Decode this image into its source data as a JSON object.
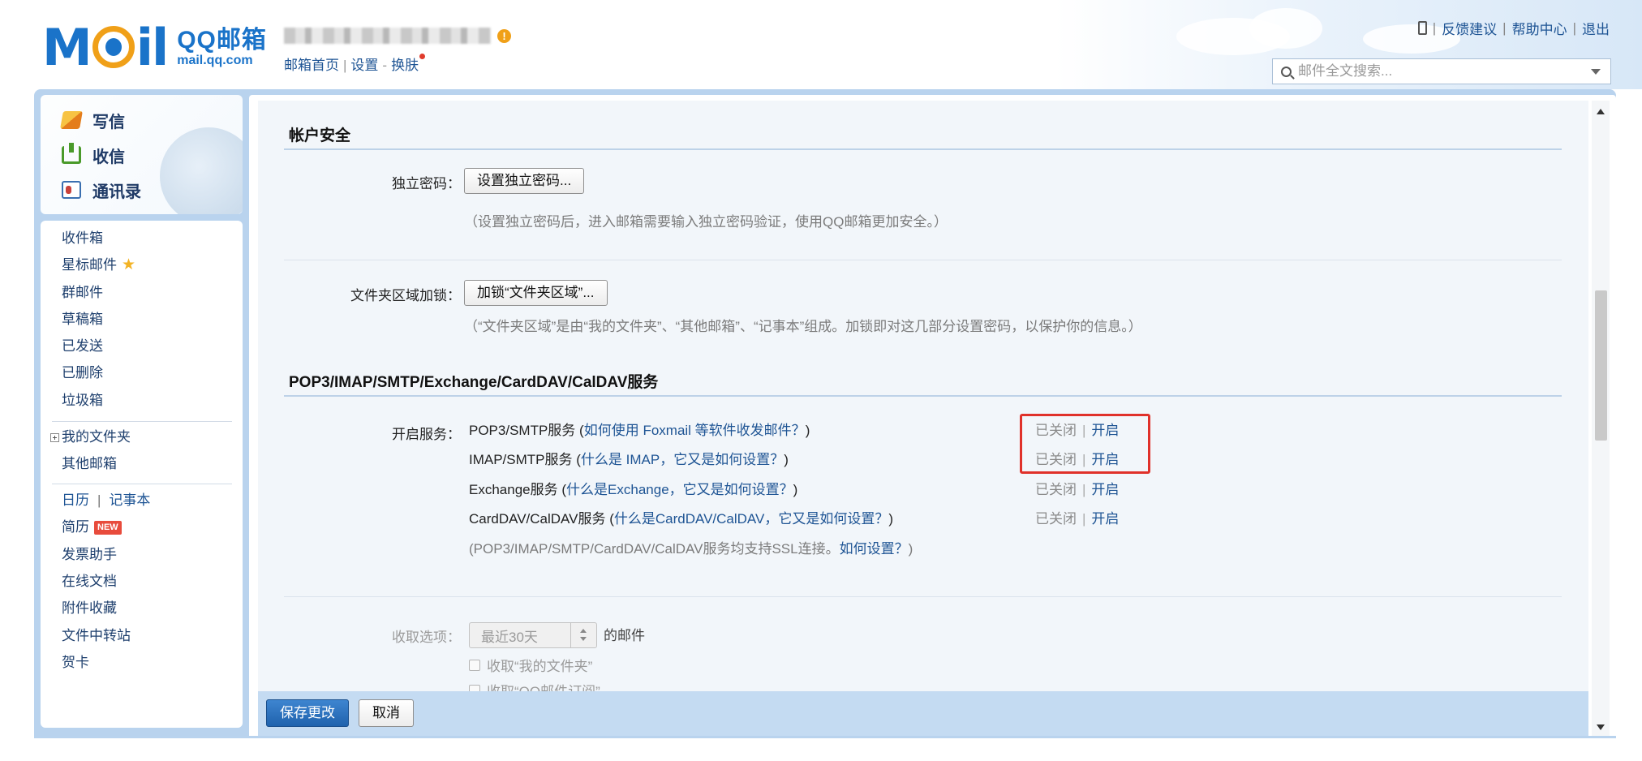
{
  "header": {
    "logo_cn": "QQ邮箱",
    "logo_en": "mail.qq.com",
    "user_links": [
      "邮箱首页",
      "设置",
      "换肤"
    ],
    "top_links": [
      "反馈建议",
      "帮助中心",
      "退出"
    ],
    "search_placeholder": "邮件全文搜索..."
  },
  "sidebar": {
    "actions": [
      "写信",
      "收信",
      "通讯录"
    ],
    "folders": [
      "收件箱",
      "星标邮件",
      "群邮件",
      "草稿箱",
      "已发送",
      "已删除",
      "垃圾箱"
    ],
    "my_folders": "我的文件夹",
    "other_mailbox": "其他邮箱",
    "calendar": "日历",
    "notes": "记事本",
    "resume": "简历",
    "new_badge": "NEW",
    "tools": [
      "发票助手",
      "在线文档",
      "附件收藏",
      "文件中转站",
      "贺卡"
    ]
  },
  "account_security": {
    "title": "帐户安全",
    "independent_password_label": "独立密码：",
    "independent_password_button": "设置独立密码...",
    "independent_password_hint": "（设置独立密码后，进入邮箱需要输入独立密码验证，使用QQ邮箱更加安全。）",
    "folder_lock_label": "文件夹区域加锁：",
    "folder_lock_button": "加锁“文件夹区域”...",
    "folder_lock_hint": "（“文件夹区域”是由“我的文件夹”、“其他邮箱”、“记事本”组成。加锁即对这几部分设置密码，以保护你的信息。）"
  },
  "services": {
    "title": "POP3/IMAP/SMTP/Exchange/CardDAV/CalDAV服务",
    "enable_label": "开启服务：",
    "items": [
      {
        "name": "POP3/SMTP服务",
        "help": "如何使用 Foxmail 等软件收发邮件？",
        "status": "已关闭",
        "action": "开启"
      },
      {
        "name": "IMAP/SMTP服务",
        "help": "什么是 IMAP，它又是如何设置？",
        "status": "已关闭",
        "action": "开启"
      },
      {
        "name": "Exchange服务",
        "help": "什么是Exchange，它又是如何设置？",
        "status": "已关闭",
        "action": "开启"
      },
      {
        "name": "CardDAV/CalDAV服务",
        "help": "什么是CardDAV/CalDAV，它又是如何设置？",
        "status": "已关闭",
        "action": "开启"
      }
    ],
    "ssl_note": "POP3/IMAP/SMTP/CardDAV/CalDAV服务均支持SSL连接。",
    "ssl_link": "如何设置？"
  },
  "receive": {
    "label": "收取选项：",
    "range_value": "最近30天",
    "suffix": "的邮件",
    "options": [
      "收取“我的文件夹”",
      "收取“QQ邮件订阅”"
    ]
  },
  "footer": {
    "save": "保存更改",
    "cancel": "取消"
  }
}
